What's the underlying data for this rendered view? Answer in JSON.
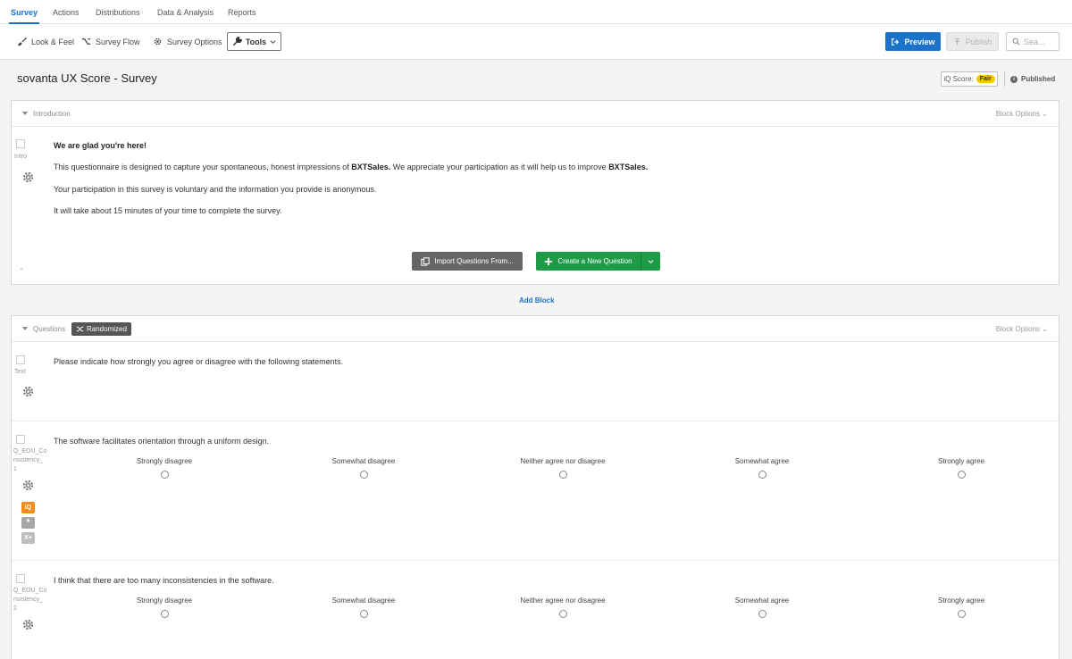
{
  "nav": {
    "tabs": [
      {
        "label": "Survey"
      },
      {
        "label": "Actions"
      },
      {
        "label": "Distributions"
      },
      {
        "label": "Data & Analysis"
      },
      {
        "label": "Reports"
      }
    ]
  },
  "toolbar": {
    "look_feel": "Look & Feel",
    "survey_flow": "Survey Flow",
    "survey_options": "Survey Options",
    "tools": "Tools",
    "preview": "Preview",
    "publish": "Publish",
    "search_placeholder": "Sea..."
  },
  "header": {
    "title": "sovanta UX Score  - Survey",
    "iq_label": "iQ Score:",
    "iq_value": "Fair",
    "status": "Published"
  },
  "block1": {
    "name": "Introduction",
    "options": "Block Options",
    "question": {
      "id": "Intro",
      "heading": "We are glad you're here!",
      "p1_pre": "This questionnaire is designed to capture your spontaneous, honest impressions of ",
      "p1_b1": "BXTSales.",
      "p1_mid": " We appreciate your participation as it will help us to improve ",
      "p1_b2": "BXTSales.",
      "p2": "Your participation in this survey is voluntary and the information you provide is anonymous.",
      "p3": "It will take about 15 minutes of your time to complete the survey."
    },
    "import_label": "Import Questions From...",
    "create_label": "Create a New Question"
  },
  "add_block": "Add Block",
  "block2": {
    "name": "Questions",
    "randomized": "Randomized",
    "options": "Block Options",
    "text_q": {
      "id": "Text",
      "text": "Please indicate how strongly you agree or disagree with the following statements."
    },
    "q1": {
      "id": "Q_EOU_Co nsistency_ 1",
      "text": "The software facilitates orientation through a uniform design."
    },
    "q2": {
      "id": "Q_EOU_Co nsistency_ 2",
      "text": "I think that there are too many inconsistencies in the software."
    },
    "scale": [
      "Strongly disagree",
      "Somewhat disagree",
      "Neither agree nor disagree",
      "Somewhat agree",
      "Strongly agree"
    ],
    "badges": {
      "iq": "iQ",
      "star": "*",
      "x": "X+"
    }
  },
  "colors": {
    "accent": "#1a73c8",
    "create": "#1e9b47",
    "fair": "#f6c600",
    "iq_badge": "#f28c1a"
  }
}
